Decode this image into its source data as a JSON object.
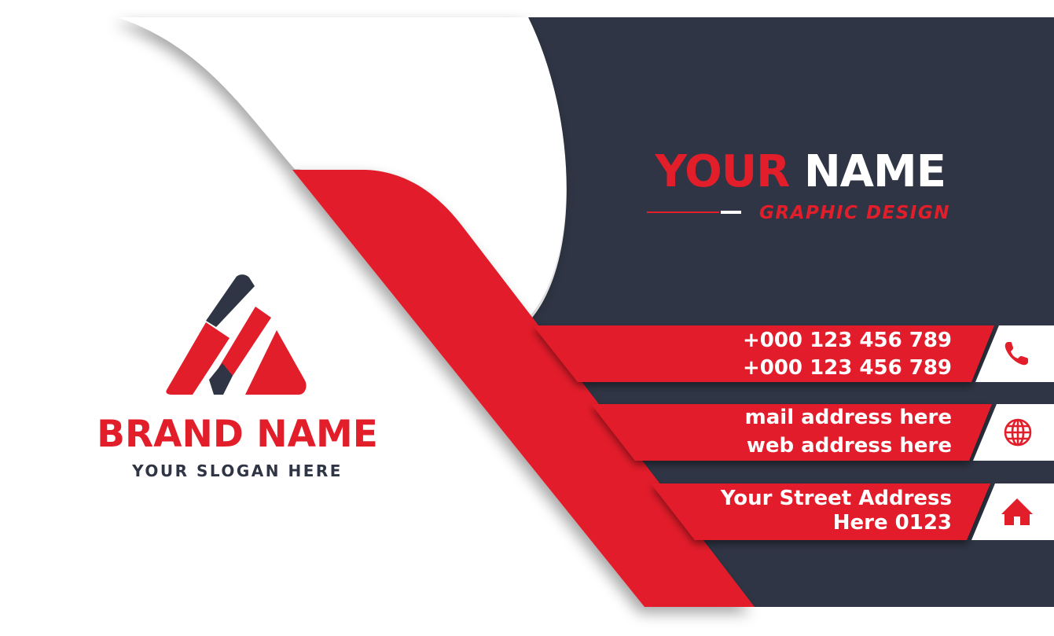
{
  "brand": {
    "name": "BRAND NAME",
    "slogan": "YOUR SLOGAN HERE"
  },
  "person": {
    "first_name": "YOUR",
    "last_name": "NAME",
    "title": "GRAPHIC DESIGN"
  },
  "contacts": {
    "phone_1": "+000 123 456 789",
    "phone_2": "+000 123 456 789",
    "mail": "mail address here",
    "web": "web address here",
    "address_line_1": "Your Street Address",
    "address_line_2": "Here 0123"
  },
  "icons": {
    "phone": "phone-icon",
    "web": "globe-icon",
    "address": "home-icon",
    "logo": "triangle-logo-icon"
  },
  "colors": {
    "accent_red": "#e21e2a",
    "dark_navy": "#2f3544",
    "white": "#ffffff"
  }
}
